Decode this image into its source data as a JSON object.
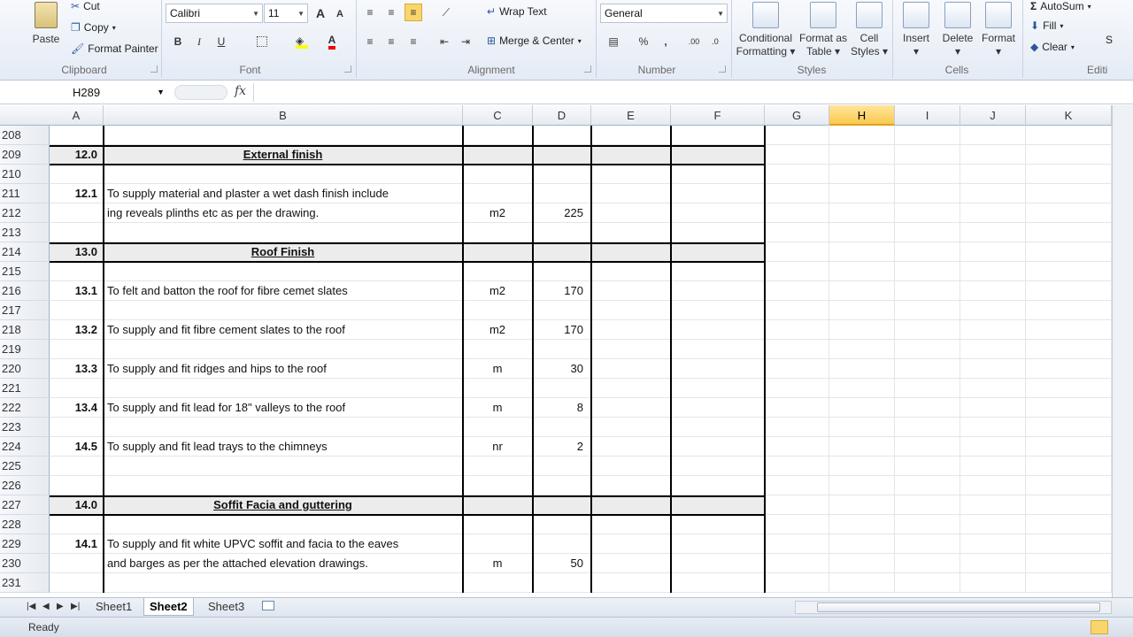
{
  "ribbon": {
    "clipboard": {
      "paste": "Paste",
      "cut": "Cut",
      "copy": "Copy",
      "format_painter": "Format Painter",
      "label": "Clipboard"
    },
    "font": {
      "name": "Calibri",
      "size": "11",
      "label": "Font",
      "bold": "B",
      "italic": "I",
      "underline": "U",
      "grow": "A",
      "shrink": "A"
    },
    "alignment": {
      "wrap_text": "Wrap Text",
      "merge_center": "Merge & Center",
      "label": "Alignment"
    },
    "number": {
      "format": "General",
      "percent": "%",
      "comma": ",",
      "label": "Number"
    },
    "styles": {
      "conditional_1": "Conditional",
      "conditional_2": "Formatting",
      "format_table_1": "Format as",
      "format_table_2": "Table",
      "cell_styles_1": "Cell",
      "cell_styles_2": "Styles",
      "label": "Styles"
    },
    "cells": {
      "insert": "Insert",
      "delete": "Delete",
      "format": "Format",
      "label": "Cells"
    },
    "editing": {
      "autosum": "AutoSum",
      "fill": "Fill",
      "clear": "Clear",
      "label": "Editi",
      "sort_partial": "S"
    }
  },
  "formula_bar": {
    "name_box": "H289",
    "fx": "fx",
    "content": ""
  },
  "columns": [
    "A",
    "B",
    "C",
    "D",
    "E",
    "F",
    "G",
    "H",
    "I",
    "J",
    "K"
  ],
  "selected_column": "H",
  "rows": [
    {
      "n": "208",
      "a": "",
      "b": "",
      "c": "",
      "d": ""
    },
    {
      "n": "209",
      "a": "12.0",
      "b": "External finish",
      "c": "",
      "d": ""
    },
    {
      "n": "210",
      "a": "",
      "b": "",
      "c": "",
      "d": ""
    },
    {
      "n": "211",
      "a": "12.1",
      "b": "To supply material and plaster a wet dash finish include",
      "c": "",
      "d": ""
    },
    {
      "n": "212",
      "a": "",
      "b": "ing reveals plinths etc as per the drawing.",
      "c": "m2",
      "d": "225"
    },
    {
      "n": "213",
      "a": "",
      "b": "",
      "c": "",
      "d": ""
    },
    {
      "n": "214",
      "a": "13.0",
      "b": "Roof Finish",
      "c": "",
      "d": ""
    },
    {
      "n": "215",
      "a": "",
      "b": "",
      "c": "",
      "d": ""
    },
    {
      "n": "216",
      "a": "13.1",
      "b": "To felt and batton the roof for fibre cemet slates",
      "c": "m2",
      "d": "170"
    },
    {
      "n": "217",
      "a": "",
      "b": "",
      "c": "",
      "d": ""
    },
    {
      "n": "218",
      "a": "13.2",
      "b": "To supply and fit fibre cement slates to the roof",
      "c": "m2",
      "d": "170"
    },
    {
      "n": "219",
      "a": "",
      "b": "",
      "c": "",
      "d": ""
    },
    {
      "n": "220",
      "a": "13.3",
      "b": "To supply and fit ridges and hips to the roof",
      "c": "m",
      "d": "30"
    },
    {
      "n": "221",
      "a": "",
      "b": "",
      "c": "",
      "d": ""
    },
    {
      "n": "222",
      "a": "13.4",
      "b": "To supply and fit lead  for 18\" valleys to the roof",
      "c": "m",
      "d": "8"
    },
    {
      "n": "223",
      "a": "",
      "b": "",
      "c": "",
      "d": ""
    },
    {
      "n": "224",
      "a": "14.5",
      "b": "To supply and fit lead  trays to the chimneys",
      "c": "nr",
      "d": "2"
    },
    {
      "n": "225",
      "a": "",
      "b": "",
      "c": "",
      "d": ""
    },
    {
      "n": "226",
      "a": "",
      "b": "",
      "c": "",
      "d": ""
    },
    {
      "n": "227",
      "a": "14.0",
      "b": "Soffit Facia and guttering",
      "c": "",
      "d": ""
    },
    {
      "n": "228",
      "a": "",
      "b": "",
      "c": "",
      "d": ""
    },
    {
      "n": "229",
      "a": "14.1",
      "b": "To supply and fit white UPVC soffit and facia to the eaves",
      "c": "",
      "d": ""
    },
    {
      "n": "230",
      "a": "",
      "b": "and barges as per the attached elevation drawings.",
      "c": "m",
      "d": "50"
    },
    {
      "n": "231",
      "a": "",
      "b": "",
      "c": "",
      "d": ""
    }
  ],
  "section_rows": [
    "209",
    "214",
    "227"
  ],
  "tabs": [
    "Sheet1",
    "Sheet2",
    "Sheet3"
  ],
  "active_tab": "Sheet2",
  "status": "Ready"
}
